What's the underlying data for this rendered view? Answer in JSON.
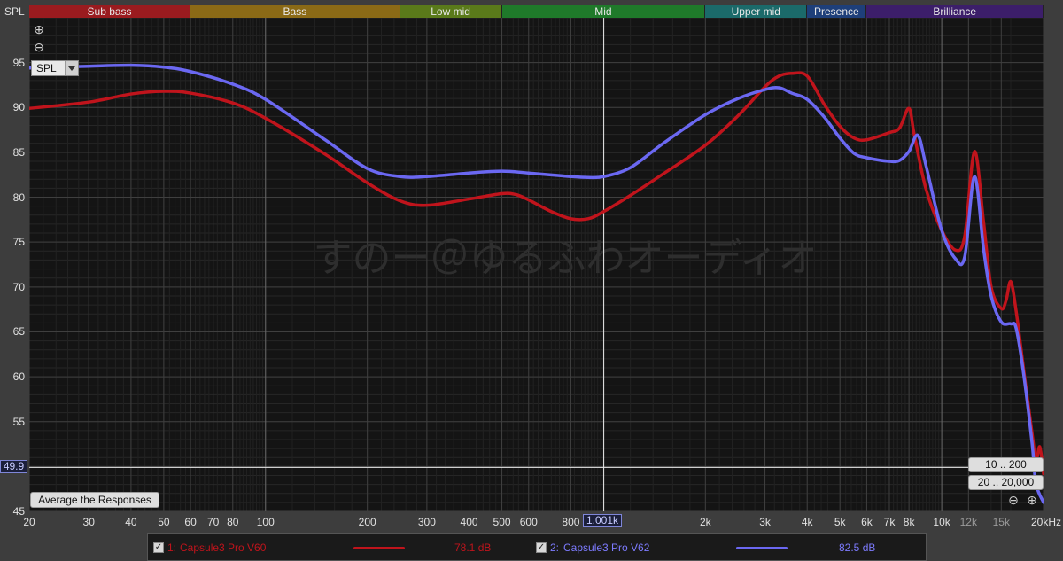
{
  "bands": [
    {
      "label": "Sub bass",
      "from": 20,
      "to": 60,
      "color": "#9a1b1f"
    },
    {
      "label": "Bass",
      "from": 60,
      "to": 250,
      "color": "#8b6a16"
    },
    {
      "label": "Low mid",
      "from": 250,
      "to": 500,
      "color": "#5a7a1a"
    },
    {
      "label": "Mid",
      "from": 500,
      "to": 2000,
      "color": "#1f7a2a"
    },
    {
      "label": "Upper mid",
      "from": 2000,
      "to": 4000,
      "color": "#1b6a6a"
    },
    {
      "label": "Presence",
      "from": 4000,
      "to": 6000,
      "color": "#1e3f7a"
    },
    {
      "label": "Brilliance",
      "from": 6000,
      "to": 20000,
      "color": "#3c1e6a"
    }
  ],
  "spl_title": "SPL",
  "spl_select": "SPL",
  "average_button": "Average the Responses",
  "range_buttons": [
    "10 .. 200",
    "20 .. 20,000"
  ],
  "cursor": {
    "y_value": "49.9",
    "x_value": "1.001k"
  },
  "watermark": "すのー＠ゆるふわオーディオ",
  "colors": {
    "series1": "#c0141c",
    "series2": "#6b68f2",
    "grid": "#3a3a3a"
  },
  "legend": [
    {
      "index": "1:",
      "name": "Capsule3 Pro V60",
      "value": "78.1 dB",
      "color": "#c0141c",
      "checked": true
    },
    {
      "index": "2:",
      "name": "Capsule3 Pro V62",
      "value": "82.5 dB",
      "color": "#6b68f2",
      "checked": true
    }
  ],
  "chart_data": {
    "type": "line",
    "xscale": "log",
    "xlim": [
      20,
      20000
    ],
    "ylim": [
      45,
      100
    ],
    "ylabel": "SPL",
    "xlabel": "",
    "y_ticks": [
      95,
      90,
      85,
      80,
      75,
      70,
      65,
      60,
      55,
      50,
      45
    ],
    "x_ticks": [
      {
        "v": 20,
        "label": "20"
      },
      {
        "v": 30,
        "label": "30"
      },
      {
        "v": 40,
        "label": "40"
      },
      {
        "v": 50,
        "label": "50"
      },
      {
        "v": 60,
        "label": "60"
      },
      {
        "v": 70,
        "label": "70"
      },
      {
        "v": 80,
        "label": "80"
      },
      {
        "v": 100,
        "label": "100"
      },
      {
        "v": 200,
        "label": "200"
      },
      {
        "v": 300,
        "label": "300"
      },
      {
        "v": 400,
        "label": "400"
      },
      {
        "v": 500,
        "label": "500"
      },
      {
        "v": 600,
        "label": "600"
      },
      {
        "v": 800,
        "label": "800"
      },
      {
        "v": 2000,
        "label": "2k"
      },
      {
        "v": 3000,
        "label": "3k"
      },
      {
        "v": 4000,
        "label": "4k"
      },
      {
        "v": 5000,
        "label": "5k"
      },
      {
        "v": 6000,
        "label": "6k"
      },
      {
        "v": 7000,
        "label": "7k"
      },
      {
        "v": 8000,
        "label": "8k"
      },
      {
        "v": 10000,
        "label": "10k"
      },
      {
        "v": 12000,
        "label": "12k",
        "dim": true
      },
      {
        "v": 15000,
        "label": "15k",
        "dim": true
      },
      {
        "v": 20000,
        "label": "20kHz"
      }
    ],
    "x_cursor": 1001,
    "y_cursor": 49.9,
    "grid": true,
    "series": [
      {
        "name": "1: Capsule3 Pro V60",
        "color": "#c0141c",
        "points": [
          [
            20,
            89.9
          ],
          [
            30,
            90.6
          ],
          [
            40,
            91.5
          ],
          [
            50,
            91.8
          ],
          [
            60,
            91.6
          ],
          [
            80,
            90.5
          ],
          [
            100,
            88.8
          ],
          [
            150,
            84.8
          ],
          [
            200,
            81.6
          ],
          [
            250,
            79.6
          ],
          [
            300,
            79.1
          ],
          [
            400,
            79.8
          ],
          [
            500,
            80.4
          ],
          [
            550,
            80.3
          ],
          [
            600,
            79.7
          ],
          [
            700,
            78.4
          ],
          [
            800,
            77.6
          ],
          [
            900,
            77.6
          ],
          [
            1000,
            78.4
          ],
          [
            1200,
            80.2
          ],
          [
            1500,
            82.6
          ],
          [
            2000,
            85.8
          ],
          [
            2500,
            89.1
          ],
          [
            3000,
            92.3
          ],
          [
            3300,
            93.5
          ],
          [
            3600,
            93.8
          ],
          [
            4000,
            93.5
          ],
          [
            4500,
            90.3
          ],
          [
            5000,
            87.9
          ],
          [
            5500,
            86.6
          ],
          [
            6000,
            86.4
          ],
          [
            7000,
            87.2
          ],
          [
            7500,
            87.7
          ],
          [
            8000,
            89.9
          ],
          [
            8300,
            86.9
          ],
          [
            9000,
            80.8
          ],
          [
            10000,
            76.3
          ],
          [
            11000,
            74.1
          ],
          [
            11700,
            75.7
          ],
          [
            12500,
            85.1
          ],
          [
            13300,
            77.2
          ],
          [
            14000,
            70.0
          ],
          [
            15000,
            67.6
          ],
          [
            15500,
            68.5
          ],
          [
            16000,
            70.6
          ],
          [
            16600,
            67.3
          ],
          [
            17500,
            60.6
          ],
          [
            18500,
            53.7
          ],
          [
            19000,
            50.7
          ],
          [
            19500,
            52.2
          ],
          [
            20000,
            49.2
          ]
        ]
      },
      {
        "name": "2: Capsule3 Pro V62",
        "color": "#6b68f2",
        "points": [
          [
            20,
            94.4
          ],
          [
            30,
            94.6
          ],
          [
            40,
            94.7
          ],
          [
            50,
            94.5
          ],
          [
            60,
            94.0
          ],
          [
            80,
            92.6
          ],
          [
            100,
            90.9
          ],
          [
            150,
            86.4
          ],
          [
            200,
            83.2
          ],
          [
            250,
            82.3
          ],
          [
            300,
            82.3
          ],
          [
            400,
            82.7
          ],
          [
            500,
            82.9
          ],
          [
            600,
            82.7
          ],
          [
            800,
            82.3
          ],
          [
            900,
            82.2
          ],
          [
            1000,
            82.3
          ],
          [
            1200,
            83.3
          ],
          [
            1500,
            86.0
          ],
          [
            2000,
            89.2
          ],
          [
            2500,
            91.0
          ],
          [
            3000,
            92.0
          ],
          [
            3300,
            92.2
          ],
          [
            3600,
            91.6
          ],
          [
            4000,
            90.9
          ],
          [
            4500,
            88.9
          ],
          [
            5000,
            86.6
          ],
          [
            5500,
            84.9
          ],
          [
            6000,
            84.4
          ],
          [
            7000,
            84.0
          ],
          [
            7500,
            84.1
          ],
          [
            8000,
            85.1
          ],
          [
            8500,
            86.9
          ],
          [
            9000,
            83.4
          ],
          [
            10000,
            76.3
          ],
          [
            11000,
            73.1
          ],
          [
            11700,
            73.4
          ],
          [
            12500,
            82.3
          ],
          [
            13300,
            74.2
          ],
          [
            14000,
            69.0
          ],
          [
            15000,
            66.1
          ],
          [
            16000,
            65.9
          ],
          [
            16600,
            65.4
          ],
          [
            17500,
            60.1
          ],
          [
            18500,
            52.6
          ],
          [
            19000,
            48.1
          ],
          [
            20000,
            46.0
          ]
        ]
      }
    ]
  }
}
